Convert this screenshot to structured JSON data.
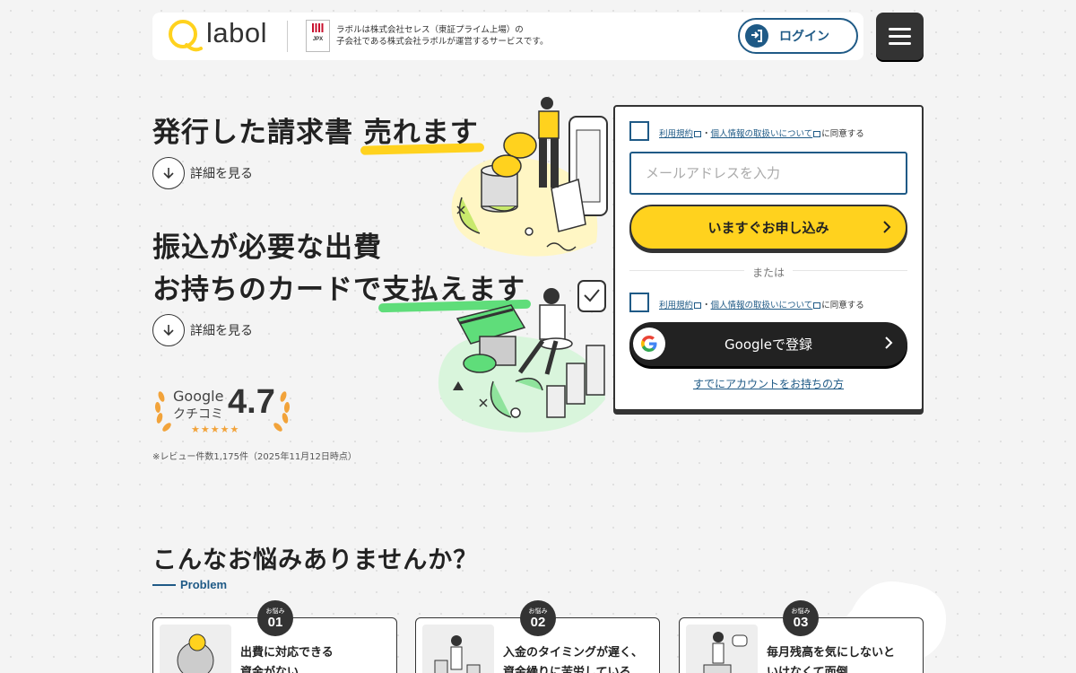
{
  "header": {
    "logo_text": "labol",
    "jpx_label": "JPX",
    "note_line1": "ラボルは株式会社セレス（東証プライム上場）の",
    "note_line2": "子会社である株式会社ラボルが運営するサービスです。",
    "login_label": "ログイン"
  },
  "hero": {
    "block1": {
      "title_plain": "発行した請求書 ",
      "title_highlight": "売れます",
      "detail_label": "詳細を見る"
    },
    "block2": {
      "title_line1": "振込が必要な出費",
      "title_line2_plain": "お持ちのカードで",
      "title_line2_highlight": "支払えます",
      "detail_label": "詳細を見る"
    },
    "review": {
      "brand": "Google",
      "kuchikomi": "クチコミ",
      "score": "4.7",
      "stars": "★★★★★",
      "note": "※レビュー件数1,175件（2025年11月12日時点）"
    }
  },
  "form": {
    "terms_link": "利用規約",
    "separator": "・",
    "privacy_link": "個人情報の取扱いについて",
    "agree_suffix": "に同意する",
    "email_placeholder": "メールアドレスを入力",
    "apply_label": "いますぐお申し込み",
    "or_text": "または",
    "google_label": "Googleで登録",
    "has_account_link": "すでにアカウントをお持ちの方"
  },
  "problem": {
    "title": "こんなお悩みありませんか？",
    "subtitle": "Problem",
    "badge_label": "お悩み",
    "cards": [
      {
        "num": "01",
        "line1": "出費に対応できる",
        "line2": "資金がない…"
      },
      {
        "num": "02",
        "line1": "入金のタイミングが遅く、",
        "line2": "資金繰りに苦労している…"
      },
      {
        "num": "03",
        "line1": "毎月残高を気にしないと",
        "line2": "いけなくて面倒…"
      }
    ]
  },
  "colors": {
    "accent_yellow": "#ffd21e",
    "accent_green": "#5fdd7a",
    "brand_blue": "#1f5a86",
    "dark": "#333333"
  }
}
